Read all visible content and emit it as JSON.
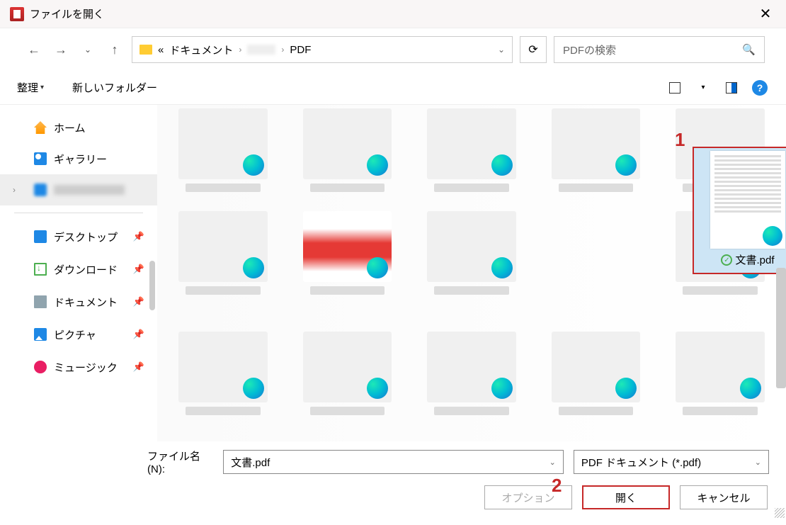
{
  "window": {
    "title": "ファイルを開く"
  },
  "nav": {
    "path_sep": "«",
    "path1": "ドキュメント",
    "path2": "PDF",
    "chev": "›"
  },
  "search": {
    "placeholder": "PDFの検索"
  },
  "toolbar": {
    "organize": "整理",
    "newfolder": "新しいフォルダー",
    "drop": "▾"
  },
  "sidebar": {
    "home": "ホーム",
    "gallery": "ギャラリー",
    "desktop": "デスクトップ",
    "download": "ダウンロード",
    "document": "ドキュメント",
    "picture": "ピクチャ",
    "music": "ミュージック"
  },
  "selected": {
    "name": "文書.pdf"
  },
  "bottom": {
    "filename_label": "ファイル名(N):",
    "filename_value": "文書.pdf",
    "filter": "PDF ドキュメント (*.pdf)",
    "option": "オプション",
    "open": "開く",
    "cancel": "キャンセル"
  },
  "annotations": {
    "one": "1",
    "two": "2"
  }
}
